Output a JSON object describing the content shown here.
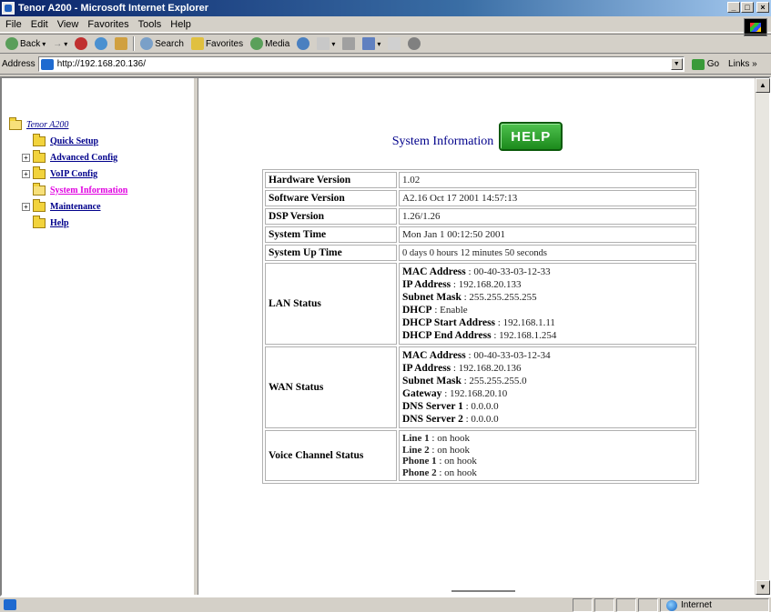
{
  "window": {
    "title": "Tenor A200 - Microsoft Internet Explorer",
    "min": "_",
    "max": "□",
    "close": "×"
  },
  "menu": [
    "File",
    "Edit",
    "View",
    "Favorites",
    "Tools",
    "Help"
  ],
  "toolbar": {
    "back": "Back",
    "search": "Search",
    "favorites": "Favorites",
    "media": "Media"
  },
  "address": {
    "label": "Address",
    "url": "http://192.168.20.136/",
    "go": "Go",
    "links": "Links »"
  },
  "sidebar": {
    "root": "Tenor A200",
    "items": [
      {
        "label": "Quick Setup",
        "expandable": false
      },
      {
        "label": "Advanced Config",
        "expandable": true
      },
      {
        "label": "VoIP Config",
        "expandable": true
      },
      {
        "label": "System Information",
        "expandable": false,
        "active": true
      },
      {
        "label": "Maintenance",
        "expandable": true
      },
      {
        "label": "Help",
        "expandable": false
      }
    ]
  },
  "main": {
    "title": "System Information",
    "help_label": "HELP",
    "rows": {
      "hardware": {
        "label": "Hardware Version",
        "value": "1.02"
      },
      "software": {
        "label": "Software Version",
        "value": "A2.16 Oct 17 2001 14:57:13"
      },
      "dsp": {
        "label": "DSP Version",
        "value": "1.26/1.26"
      },
      "time": {
        "label": "System Time",
        "value": "Mon Jan 1 00:12:50 2001"
      },
      "uptime": {
        "label": "System Up Time",
        "value": "0 days 0 hours 12 minutes 50 seconds"
      },
      "lan": {
        "label": "LAN Status",
        "lines": [
          {
            "k": "MAC Address",
            "v": " : 00-40-33-03-12-33"
          },
          {
            "k": "IP Address",
            "v": " : 192.168.20.133"
          },
          {
            "k": "Subnet Mask",
            "v": " : 255.255.255.255"
          },
          {
            "k": "DHCP",
            "v": " : Enable"
          },
          {
            "k": "DHCP Start Address",
            "v": " : 192.168.1.11"
          },
          {
            "k": "DHCP End Address",
            "v": " : 192.168.1.254"
          }
        ]
      },
      "wan": {
        "label": "WAN Status",
        "lines": [
          {
            "k": "MAC Address",
            "v": " : 00-40-33-03-12-34"
          },
          {
            "k": "IP Address",
            "v": " : 192.168.20.136"
          },
          {
            "k": "Subnet Mask",
            "v": " : 255.255.255.0"
          },
          {
            "k": "Gateway",
            "v": " : 192.168.20.10"
          },
          {
            "k": "DNS Server 1",
            "v": " : 0.0.0.0"
          },
          {
            "k": "DNS Server 2",
            "v": " : 0.0.0.0"
          }
        ]
      },
      "voice": {
        "label": "Voice Channel Status",
        "lines": [
          {
            "k": "Line 1",
            "v": " : on hook"
          },
          {
            "k": "Line 2",
            "v": " : on hook"
          },
          {
            "k": "Phone 1",
            "v": " : on hook"
          },
          {
            "k": "Phone 2",
            "v": " : on hook"
          }
        ]
      }
    }
  },
  "status": {
    "zone": "Internet"
  }
}
